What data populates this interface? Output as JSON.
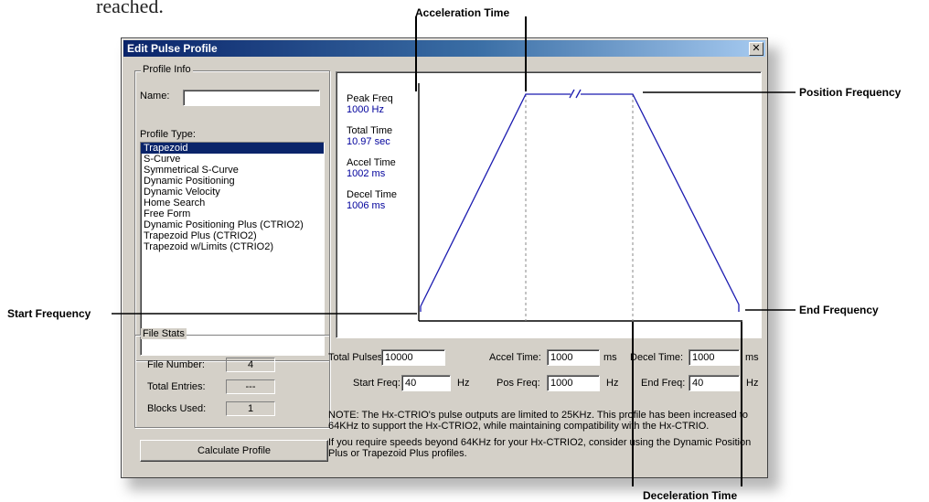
{
  "document": {
    "heading_fragment": "reached."
  },
  "dialog": {
    "title": "Edit Pulse Profile",
    "close_glyph": "✕",
    "profile_info": {
      "group_label": "Profile Info",
      "name_label": "Name:",
      "name_value": "",
      "profile_type_label": "Profile Type:",
      "profile_types": [
        "Trapezoid",
        "S-Curve",
        "Symmetrical S-Curve",
        "Dynamic Positioning",
        "Dynamic Velocity",
        "Home Search",
        "Free Form",
        "Dynamic Positioning Plus (CTRIO2)",
        "Trapezoid Plus (CTRIO2)",
        "Trapezoid w/Limits (CTRIO2)"
      ],
      "selected_profile": "Trapezoid"
    },
    "file_stats": {
      "group_label": "File Stats",
      "file_number_label": "File Number:",
      "file_number": "4",
      "total_entries_label": "Total Entries:",
      "total_entries": "---",
      "blocks_used_label": "Blocks Used:",
      "blocks_used": "1"
    },
    "calculate_button": "Calculate Profile",
    "chart_info": {
      "peak_freq_label": "Peak Freq",
      "peak_freq": "1000 Hz",
      "total_time_label": "Total Time",
      "total_time": "10.97 sec",
      "accel_time_label": "Accel Time",
      "accel_time": "1002 ms",
      "decel_time_label": "Decel Time",
      "decel_time": "1006 ms"
    },
    "params": {
      "total_pulses_label": "Total Pulses:",
      "total_pulses": "10000",
      "accel_time_label": "Accel Time:",
      "accel_time": "1000",
      "accel_unit": "ms",
      "decel_time_label": "Decel Time:",
      "decel_time": "1000",
      "decel_unit": "ms",
      "start_freq_label": "Start Freq:",
      "start_freq": "40",
      "start_unit": "Hz",
      "pos_freq_label": "Pos Freq:",
      "pos_freq": "1000",
      "pos_unit": "Hz",
      "end_freq_label": "End Freq:",
      "end_freq": "40",
      "end_unit": "Hz"
    },
    "note1": "NOTE: The Hx-CTRIO's pulse outputs are limited to 25KHz. This profile has been increased to 64KHz to support the Hx-CTRIO2, while maintaining compatibility with the Hx-CTRIO.",
    "note2": "If you require speeds beyond 64KHz for your Hx-CTRIO2, consider using the Dynamic Position Plus or Trapezoid Plus profiles."
  },
  "annotations": {
    "acceleration_time": "Acceleration Time",
    "position_frequency": "Position Frequency",
    "start_frequency": "Start  Frequency",
    "end_frequency": "End Frequency",
    "deceleration_time": "Deceleration Time"
  },
  "colors": {
    "profile_line": "#1b1bb0",
    "title_bar": "#0a246a",
    "info_value": "#00009c"
  }
}
